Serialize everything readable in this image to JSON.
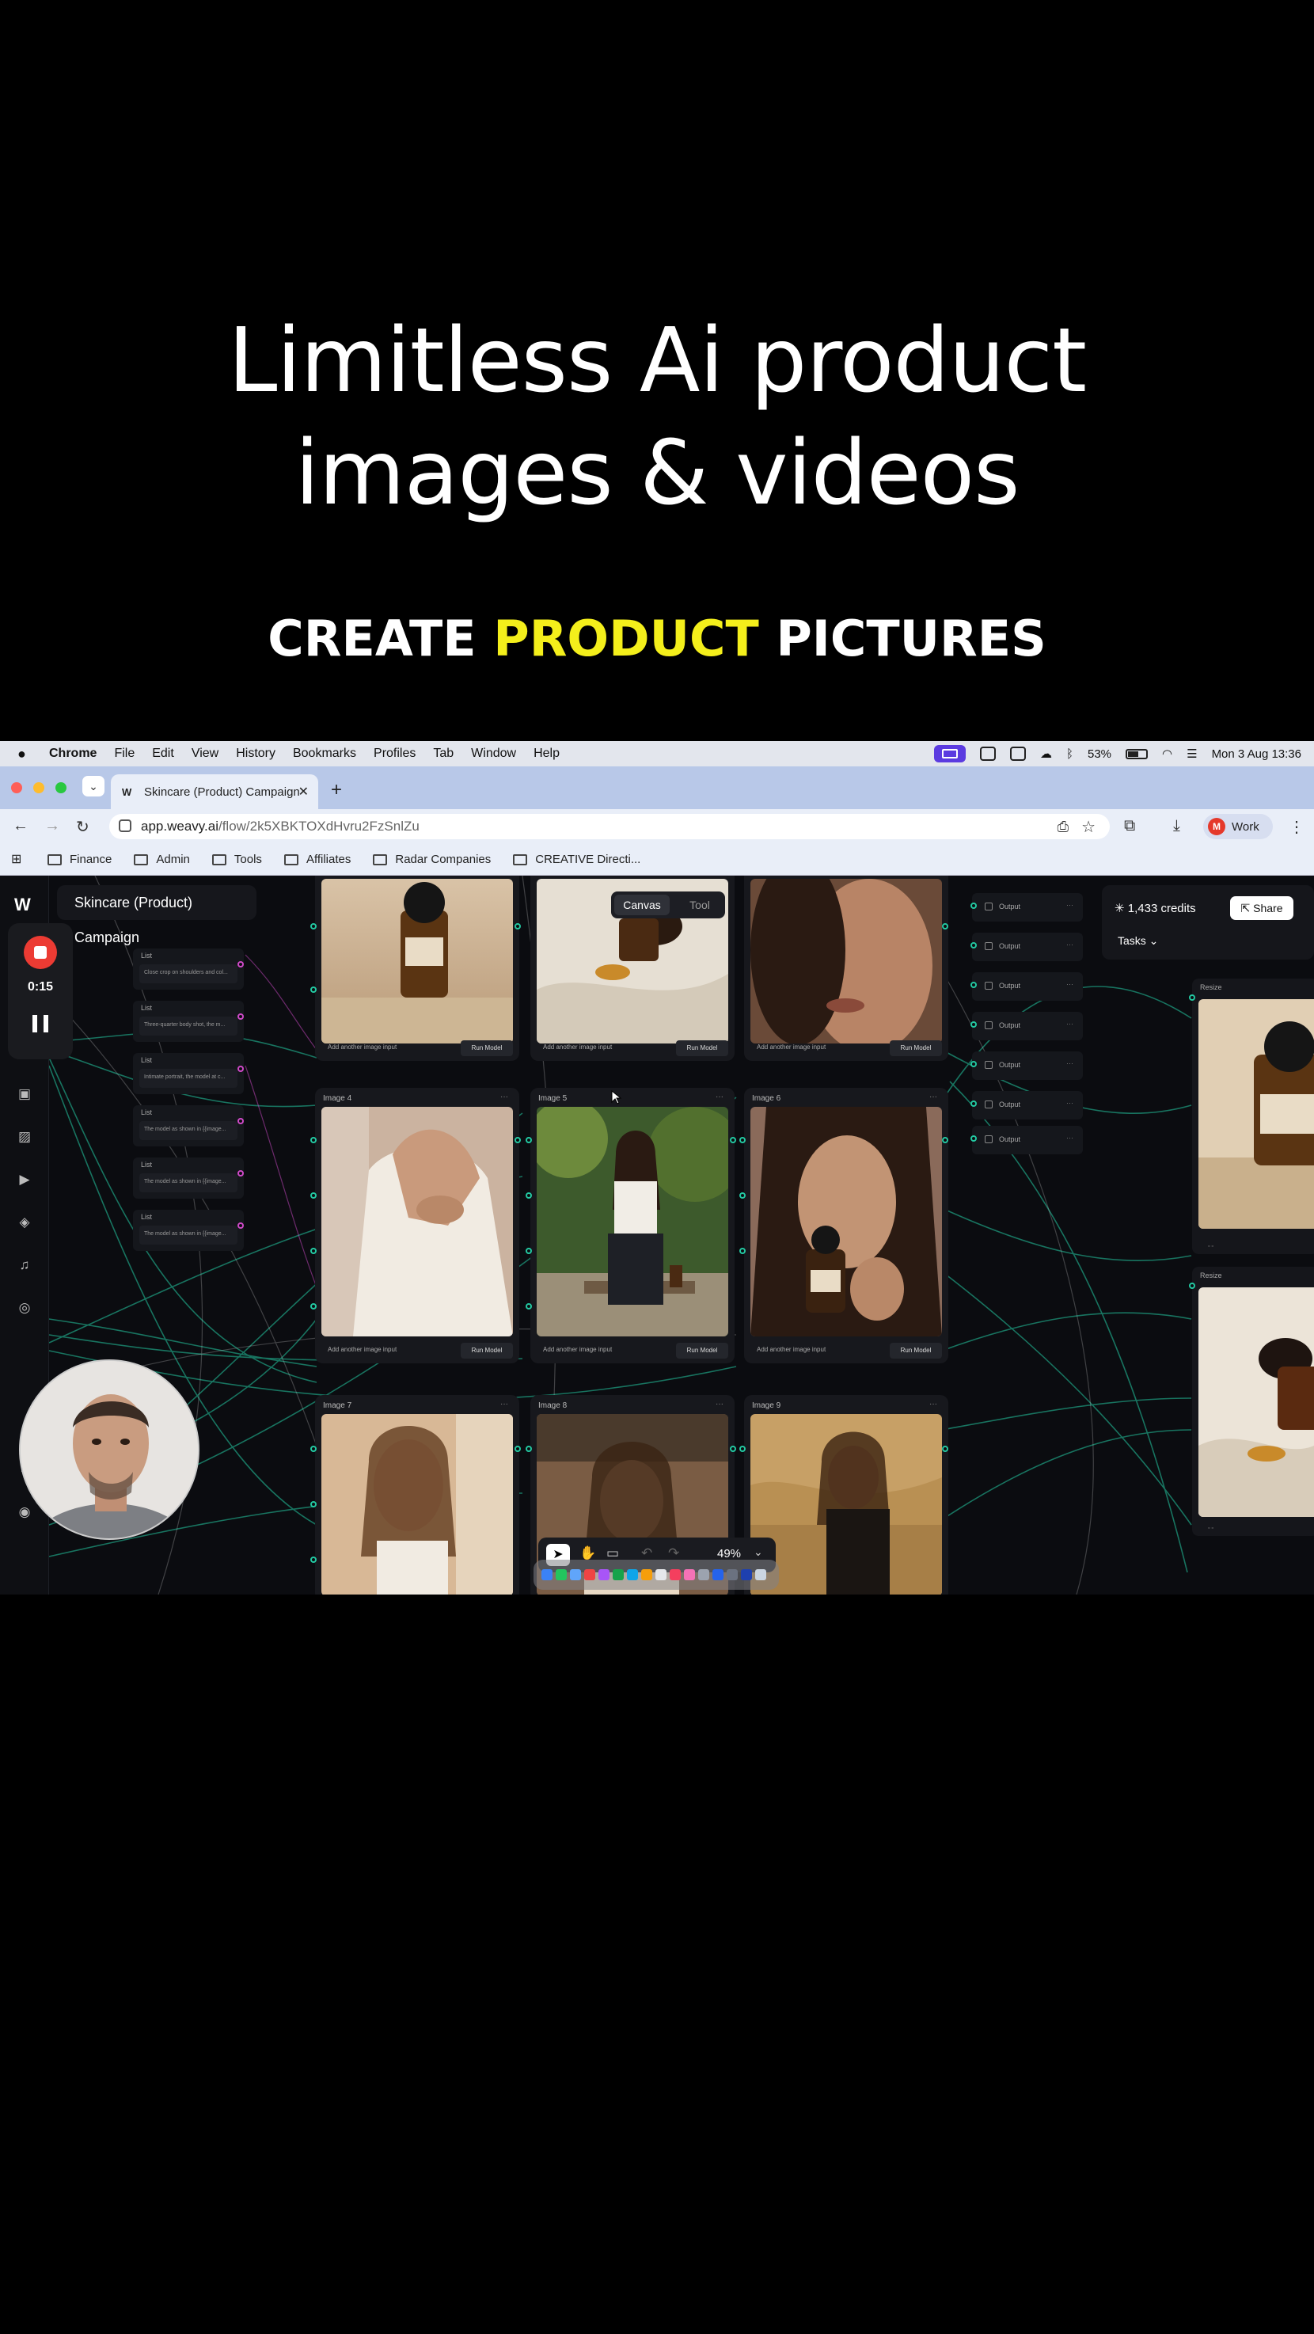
{
  "headline": {
    "line1": "Limitless Ai product",
    "line2": "images & videos"
  },
  "subhead": {
    "pre": "CREATE ",
    "highlight": "PRODUCT",
    "post": " PICTURES",
    "highlight_color": "#f4ef1b"
  },
  "menubar": {
    "items": [
      "Chrome",
      "File",
      "Edit",
      "View",
      "History",
      "Bookmarks",
      "Profiles",
      "Tab",
      "Window",
      "Help"
    ],
    "battery": "53%",
    "clock": "Mon 3 Aug  13:36"
  },
  "browser": {
    "tab_title": "Skincare (Product) Campaign",
    "url_host": "app.weavy.ai",
    "url_path": "/flow/2k5XBKTOXdHvru2FzSnlZu",
    "profile_initial": "M",
    "profile_name": "Work",
    "bookmarks": [
      "Finance",
      "Admin",
      "Tools",
      "Affiliates",
      "Radar Companies",
      "CREATIVE Directi..."
    ]
  },
  "recorder": {
    "time": "0:15"
  },
  "app": {
    "project_title": "Skincare (Product) Campaign",
    "mode_tabs": [
      "Canvas",
      "Tool"
    ],
    "credits": "1,433 credits",
    "share_label": "Share",
    "tasks_label": "Tasks",
    "zoom": "49%",
    "list_nodes": [
      {
        "label": "List",
        "text": "Close crop on shoulders and col..."
      },
      {
        "label": "List",
        "text": "Three-quarter body shot, the m..."
      },
      {
        "label": "List",
        "text": "Intimate portrait, the model at c..."
      },
      {
        "label": "List",
        "text": "The model as shown in {{image..."
      },
      {
        "label": "List",
        "text": "The model as shown in {{image..."
      },
      {
        "label": "List",
        "text": "The model as shown in {{image..."
      }
    ],
    "image_nodes": [
      "Image 4",
      "Image 5",
      "Image 6",
      "Image 7",
      "Image 8",
      "Image 9"
    ],
    "add_input_label": "Add another image input",
    "run_label": "Run Model",
    "output_label": "Output",
    "resize_label": "Resize",
    "port_color": "#23c9a2",
    "port_alt_color": "#d04ac9"
  }
}
